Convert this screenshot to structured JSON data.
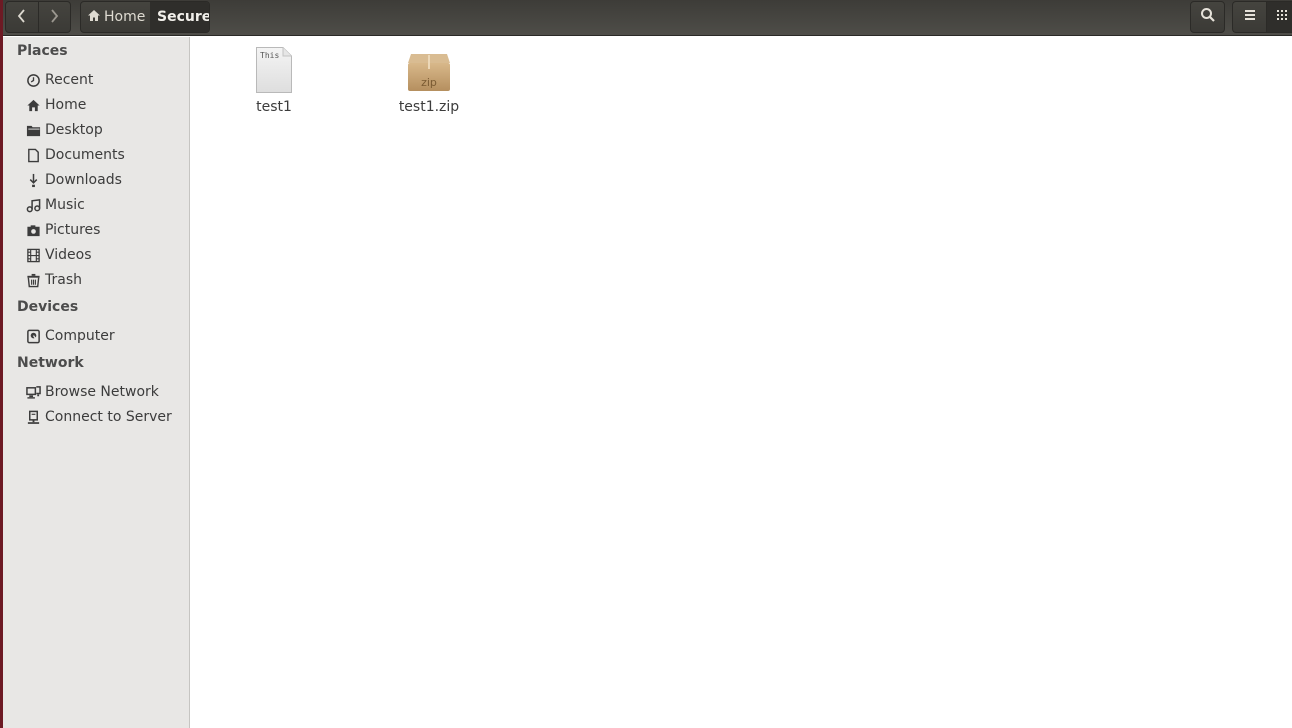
{
  "window": {
    "toolbar": {
      "back_icon": "chevron-left-icon",
      "forward_icon": "chevron-right-icon",
      "breadcrumbs": [
        {
          "label": "Home",
          "icon": "home-icon",
          "active": false
        },
        {
          "label": "Secure",
          "active": true
        }
      ],
      "search_icon": "search-icon",
      "list_view_icon": "hamburger-menu-icon",
      "grid_view_icon": "grid-icon"
    },
    "sidebar": {
      "sections": [
        {
          "title": "Places",
          "items": [
            {
              "label": "Recent",
              "icon": "clock-icon"
            },
            {
              "label": "Home",
              "icon": "home-icon"
            },
            {
              "label": "Desktop",
              "icon": "folder-icon"
            },
            {
              "label": "Documents",
              "icon": "document-icon"
            },
            {
              "label": "Downloads",
              "icon": "download-icon"
            },
            {
              "label": "Music",
              "icon": "music-icon"
            },
            {
              "label": "Pictures",
              "icon": "camera-icon"
            },
            {
              "label": "Videos",
              "icon": "film-icon"
            },
            {
              "label": "Trash",
              "icon": "trash-icon"
            }
          ]
        },
        {
          "title": "Devices",
          "items": [
            {
              "label": "Computer",
              "icon": "harddisk-icon"
            }
          ]
        },
        {
          "title": "Network",
          "items": [
            {
              "label": "Browse Network",
              "icon": "network-icon"
            },
            {
              "label": "Connect to Server",
              "icon": "server-icon"
            }
          ]
        }
      ]
    },
    "files": [
      {
        "name": "test1",
        "type": "text-file-icon",
        "preview_text": "This"
      },
      {
        "name": "test1.zip",
        "type": "zip-archive-icon",
        "badge": "zip"
      }
    ]
  }
}
